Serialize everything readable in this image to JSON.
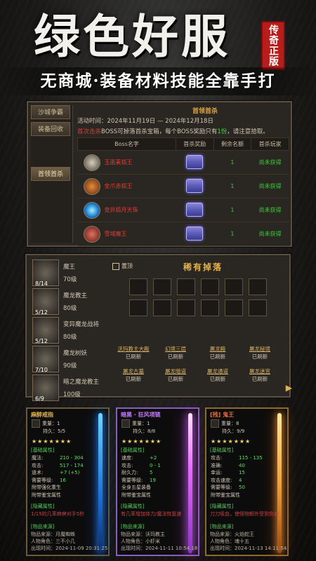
{
  "header": {
    "title": "绿色好服",
    "seal": "传奇正版",
    "slogan": "无商城·装备材料技能全靠手打"
  },
  "panel1": {
    "side_tabs": [
      "沙城争霸",
      "装备回收",
      "首领首杀"
    ],
    "banner": "首领首杀",
    "time_label": "活动时间：2024年11月19日 — 2024年12月18日",
    "desc_prefix": "首次击杀",
    "desc_mid": "BOSS可掉落首杀宝箱，每个BOSS奖励只有",
    "desc_count": "1份",
    "desc_suffix": "，请注意拾取。",
    "columns": [
      "Boss名字",
      "首杀奖励",
      "剩余名额",
      "首杀玩家"
    ],
    "rows": [
      {
        "name": "玉面素狐王",
        "remaining": "1",
        "player": "尚未获得"
      },
      {
        "name": "金爪赤狐王",
        "remaining": "1",
        "player": "尚未获得"
      },
      {
        "name": "变异狐月天珠",
        "remaining": "1",
        "player": "尚未获得"
      },
      {
        "name": "雪域魔王",
        "remaining": "1",
        "player": "尚未获得"
      }
    ]
  },
  "panel2": {
    "boss_list": [
      {
        "count": "8/14",
        "name": "魔王",
        "level": "70级"
      },
      {
        "count": "5/12",
        "name": "魔龙教主",
        "level": "80级"
      },
      {
        "count": "5/12",
        "name": "变异魔龙战将",
        "level": "80级"
      },
      {
        "count": "7/10",
        "name": "魔龙树妖",
        "level": "90级"
      },
      {
        "count": "6/9",
        "name": "暗之魔龙教主",
        "level": "100级"
      }
    ],
    "checkbox": "置顶",
    "drops_title": "稀有掉落",
    "maps": [
      {
        "name": "沃玛教主大殿",
        "status": "已刷新"
      },
      {
        "name": "幻境三层",
        "status": "已刷新"
      },
      {
        "name": "屠龙殿",
        "status": "已刷新"
      },
      {
        "name": "屠龙秘境",
        "status": "已刷新"
      },
      {
        "name": "屠龙古墓",
        "status": "已刷新"
      },
      {
        "name": "屠龙暗道",
        "status": "已刷新"
      },
      {
        "name": "屠龙通道",
        "status": "已刷新"
      },
      {
        "name": "屠龙迷宫",
        "status": "已刷新"
      }
    ]
  },
  "cards": [
    {
      "name": "麻醉戒指",
      "name_color": "#e6b34a",
      "weight": "重量：1",
      "durability": "持久：5/5",
      "stars": "★★★★★★★",
      "base_label": "[基础属性]",
      "attrs": [
        [
          "魔法:",
          "210 - 304"
        ],
        [
          "攻击:",
          "517 - 174"
        ],
        [
          "道术:",
          "+7 (+5)"
        ],
        [
          "需要等级:",
          "16"
        ],
        [
          "附带强化重生",
          ""
        ],
        [
          "附带鉴宝属性",
          ""
        ]
      ],
      "hidden_label": "[隐藏属性]",
      "hidden": "1/15的几率麻痹对手5秒",
      "src_label": "[物品来源]",
      "src_map": "物品来源：月魔蜘蛛",
      "src_who": "人物角色：三不小几",
      "src_time": "出现时间：2024-11-09 20:31:25"
    },
    {
      "name": "暗黑 · 狂风项链",
      "name_color": "#c779ff",
      "weight": "重量：1",
      "durability": "持久：8/8",
      "stars": "★★★★★★★",
      "base_label": "[基础属性]",
      "attrs": [
        [
          "速度:",
          "+2"
        ],
        [
          "攻击:",
          "0 - 1"
        ],
        [
          "耐久力:",
          "5"
        ],
        [
          "需要等级:",
          "19"
        ],
        [
          "全身五星装备",
          ""
        ],
        [
          "附带鉴宝属性",
          ""
        ]
      ],
      "hidden_label": "[隐藏属性]",
      "hidden": "有几率增加体力/魔法恢复速",
      "src_label": "[物品来源]",
      "src_map": "物品来源：沃玛教主",
      "src_who": "人物角色：小虾米",
      "src_time": "出现时间：2024-11-11 10:54:18"
    },
    {
      "name": "[残] 鬼王",
      "name_color": "#ef6b3b",
      "weight": "重量：8",
      "durability": "持久：9/9",
      "stars": "★★★★★★★",
      "base_label": "[基础属性]",
      "attrs": [
        [
          "攻击:",
          "115 - 135"
        ],
        [
          "准确:",
          "40"
        ],
        [
          "幸运:",
          "15"
        ],
        [
          "攻击速度:",
          "4"
        ],
        [
          "需要等级:",
          "50"
        ],
        [
          "附带鉴宝属性",
          ""
        ]
      ],
      "hidden_label": "[隐藏属性]",
      "hidden": "刀刀吸血，使怪物额外受到伤害",
      "src_label": "[物品来源]",
      "src_map": "物品来源：火焰蛇王",
      "src_who": "人物角色：魂十五",
      "src_time": "出现时间：2024-11-13 14:11:54"
    }
  ]
}
